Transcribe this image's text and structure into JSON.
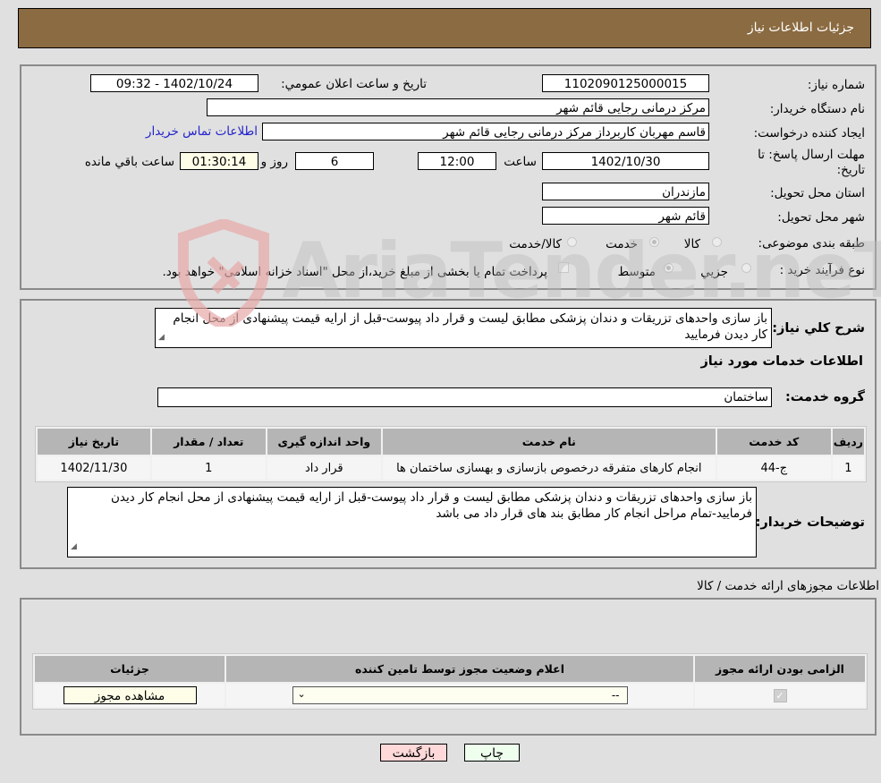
{
  "header": {
    "title": "جزئیات اطلاعات نیاز"
  },
  "details": {
    "need_number_label": "شماره نیاز:",
    "need_number": "1102090125000015",
    "announce_label": "تاریخ و ساعت اعلان عمومي:",
    "announce_value": "1402/10/24 - 09:32",
    "buyer_org_label": "نام دستگاه خریدار:",
    "buyer_org": "مرکز درمانی رجایی قائم شهر",
    "creator_label": "ایجاد کننده درخواست:",
    "creator": "قاسم مهربان کاربرداز مرکز درمانی رجایی قائم شهر",
    "contact_link": "اطلاعات تماس خریدار",
    "deadline_label_1": "مهلت ارسال پاسخ: تا",
    "deadline_label_2": "تاریخ:",
    "deadline_date": "1402/10/30",
    "time_label": "ساعت",
    "deadline_time": "12:00",
    "days_value": "6",
    "days_label": "روز و",
    "remaining_time": "01:30:14",
    "remaining_label": "ساعت باقي مانده",
    "province_label": "استان محل تحویل:",
    "province": "مازندران",
    "city_label": "شهر محل تحویل:",
    "city": "قائم شهر",
    "category_label": "طبقه بندی موضوعی:",
    "category_options": [
      {
        "label": "کالا",
        "checked": false
      },
      {
        "label": "خدمت",
        "checked": true
      },
      {
        "label": "کالا/خدمت",
        "checked": false
      }
    ],
    "process_label": "نوع فرآیند خرید :",
    "process_options": [
      {
        "label": "جزيي",
        "checked": false
      },
      {
        "label": "متوسط",
        "checked": true
      }
    ],
    "payment_note": "پرداخت تمام یا بخشی از مبلغ خرید،از محل \"اسناد خزانه اسلامی\" خواهد بود."
  },
  "description": {
    "label": "شرح کلي نیاز:",
    "text": "باز سازی واحدهای تزریقات و دندان پزشکی مطابق لیست و قرار داد پیوست-قبل از ارایه قیمت پیشنهادی از محل انجام کار دیدن فرمایید",
    "services_title": "اطلاعات خدمات مورد نیاز",
    "service_group_label": "گروه خدمت:",
    "service_group": "ساختمان"
  },
  "services_table": {
    "headers": [
      "ردیف",
      "کد خدمت",
      "نام خدمت",
      "واحد اندازه گیری",
      "تعداد / مقدار",
      "تاریخ نیاز"
    ],
    "rows": [
      [
        "1",
        "ج-44",
        "انجام کارهای متفرقه درخصوص بازسازی و بهسازی ساختمان ها",
        "قرار داد",
        "1",
        "1402/11/30"
      ]
    ]
  },
  "buyer_notes": {
    "label": "توضیحات خریدار:",
    "text": "باز سازی واحدهای تزریقات و دندان پزشکی مطابق لیست و قرار داد پیوست-قبل از ارایه قیمت پیشنهادی از محل انجام کار دیدن فرمایید-تمام مراحل انجام کار مطابق بند های قرار داد می باشد"
  },
  "permits": {
    "title": "اطلاعات مجوزهای ارائه خدمت / کالا",
    "headers": [
      "الزامی بودن ارائه مجوز",
      "اعلام وضعیت مجوز توسط تامین کننده",
      "جزئیات"
    ],
    "required_checked": true,
    "status_select": "--",
    "view_button": "مشاهده مجوز"
  },
  "footer": {
    "print_button": "چاپ",
    "back_button": "بازگشت"
  },
  "watermark": {
    "text": "AriaTender.neT"
  }
}
